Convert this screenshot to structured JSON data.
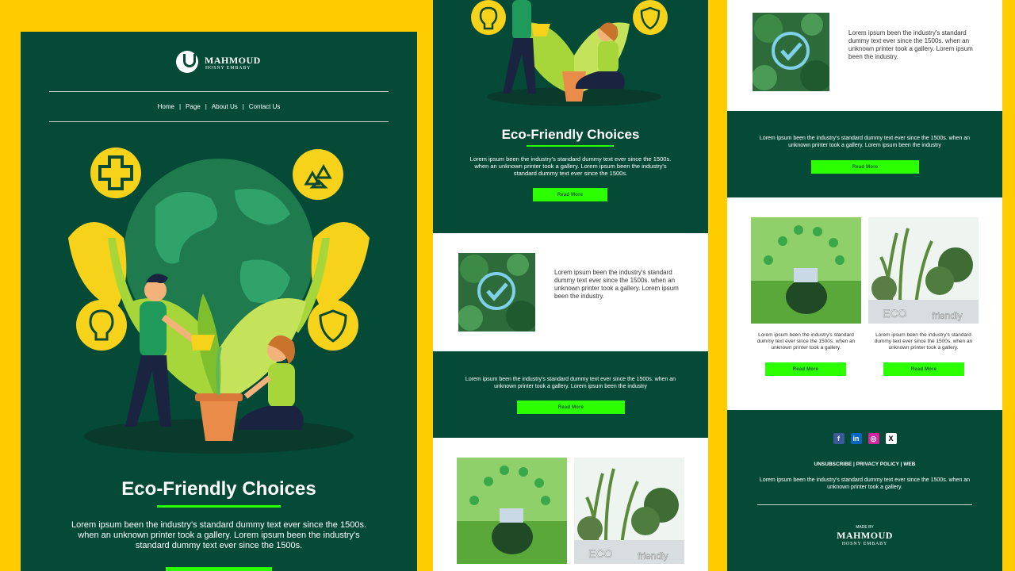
{
  "brand": {
    "name": "MAHMOUD",
    "sub": "HOSNY EMBABY",
    "made_by": "MADE BY"
  },
  "nav": [
    "Home",
    "Page",
    "About Us",
    "Contact Us"
  ],
  "nav_sep": "|",
  "hero": {
    "title": "Eco-Friendly Choices",
    "text": "Lorem ipsum been the industry's standard dummy text ever since the 1500s. when an unknown printer took a gallery. Lorem ipsum been the industry's standard dummy text ever since the 1500s."
  },
  "read_more": "Read More",
  "feature": {
    "text": "Lorem ipsum been the industry's standard dummy text ever since the 1500s. when an unknown printer took a gallery. Lorem ipsum been the industry."
  },
  "banner": {
    "text": "Lorem ipsum been the industry's standard dummy text ever since the 1500s. when an unknown printer took a gallery. Lorem ipsum been the industry"
  },
  "gallery": {
    "caption1": "Lorem ipsum been the industry's standard dummy text ever since the 1500s. when an unknown printer took a gallery.",
    "caption2": "Lorem ipsum been the industry's standard dummy text ever since the 1500s. when an unknown printer took a gallery.",
    "sign_eco": "ECO",
    "sign_friendly": "friendly"
  },
  "footer": {
    "social": [
      "f",
      "in",
      "◎",
      "X"
    ],
    "links": [
      "UNSUBSCRIBE",
      "PRIVACY POLICY",
      "WEB"
    ],
    "text": "Lorem ipsum been the industry's standard dummy text ever since the 1500s. when an unknown printer took a gallery."
  },
  "colors": {
    "background": "#ffcc00",
    "dark_green": "#044a37",
    "accent_green": "#2bff00",
    "leaf": "#a7d63b",
    "icon_yellow": "#f7d21a"
  }
}
